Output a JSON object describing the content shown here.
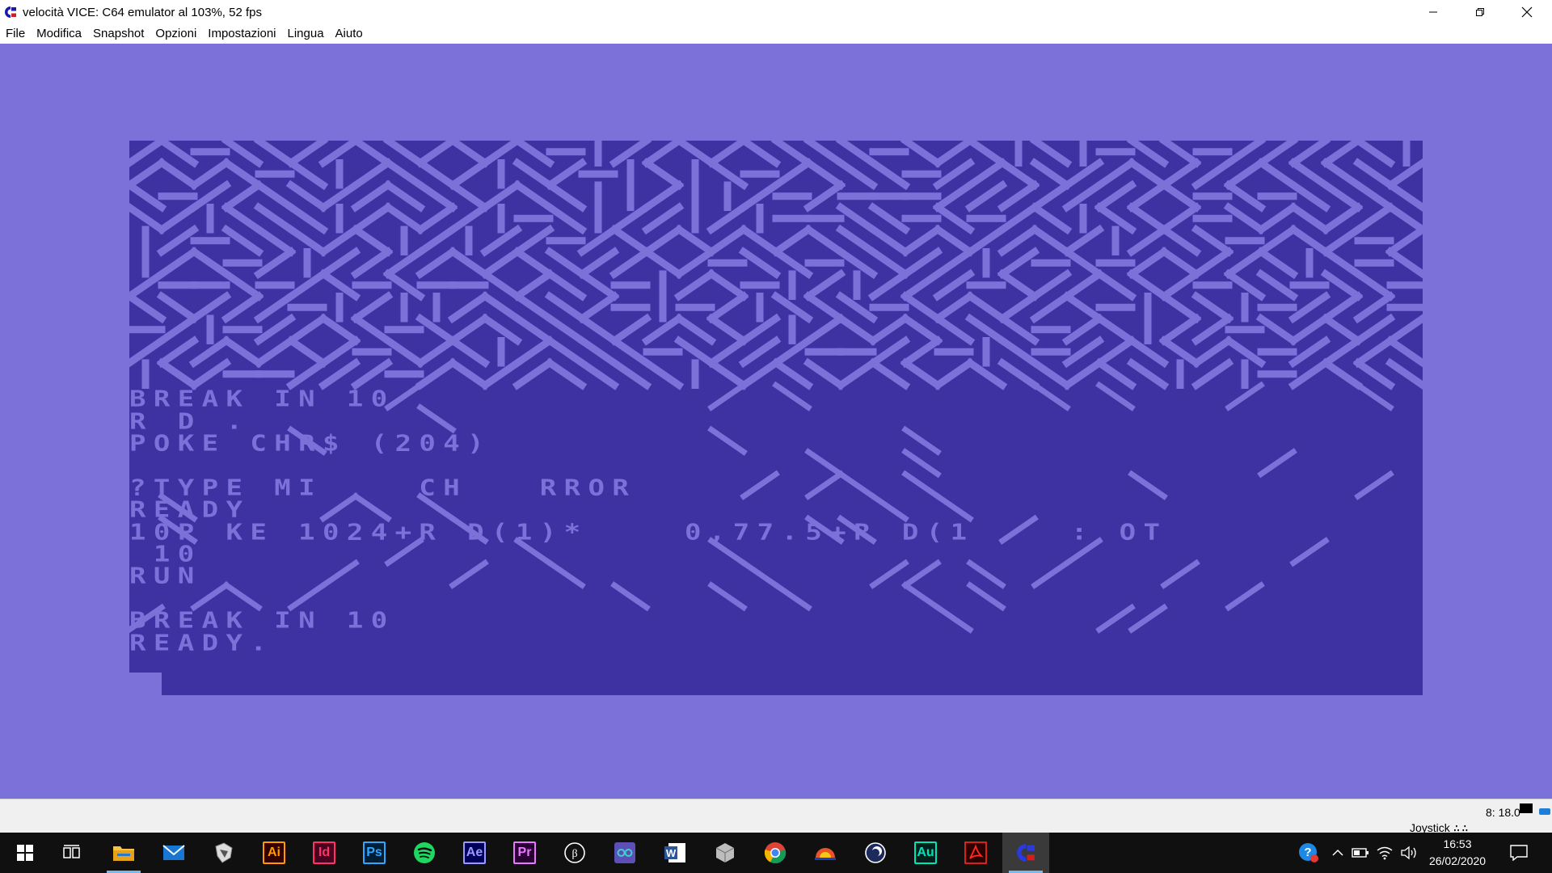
{
  "window": {
    "title": "velocità VICE: C64 emulator al 103%, 52 fps",
    "icon": "vice-commodore-icon"
  },
  "controls": {
    "minimize": "—",
    "maximize": "❐",
    "close": "✕"
  },
  "menu": {
    "items": [
      "File",
      "Modifica",
      "Snapshot",
      "Opzioni",
      "Impostazioni",
      "Lingua",
      "Aiuto"
    ]
  },
  "c64": {
    "border_color": "#7b71d9",
    "background_color": "#3e31a2",
    "text_color": "#7b71d9",
    "lines": [
      "BREAK IN 10",
      "R D .",
      "POKE CHR$ (204)",
      "",
      "?TYPE MI    CH   RROR",
      "READY",
      "10P KE 1024+R D(1)*    0,77.5+R D(1    : OT",
      " 10",
      "RUN",
      "",
      "BREAK IN 10",
      "READY."
    ]
  },
  "status": {
    "speed": "8: 18.0",
    "joystick": "Joystick"
  },
  "taskbar": {
    "apps": [
      {
        "name": "start",
        "icon": "windows-start-icon"
      },
      {
        "name": "task-view",
        "icon": "task-view-icon"
      },
      {
        "name": "file-explorer",
        "icon": "folder-icon"
      },
      {
        "name": "mail",
        "icon": "mail-icon"
      },
      {
        "name": "inkscape",
        "icon": "inkscape-icon"
      },
      {
        "name": "illustrator",
        "label": "Ai",
        "color": "#ff9a00"
      },
      {
        "name": "indesign",
        "label": "Id",
        "color": "#ff3366"
      },
      {
        "name": "photoshop",
        "label": "Ps",
        "color": "#31a8ff"
      },
      {
        "name": "spotify",
        "icon": "spotify-icon"
      },
      {
        "name": "after-effects",
        "label": "Ae",
        "color": "#9999ff"
      },
      {
        "name": "premiere",
        "label": "Pr",
        "color": "#ea77ff"
      },
      {
        "name": "beaker",
        "icon": "beaker-icon"
      },
      {
        "name": "arduino",
        "icon": "arduino-icon"
      },
      {
        "name": "word",
        "icon": "word-icon"
      },
      {
        "name": "cube-app",
        "icon": "cube-icon"
      },
      {
        "name": "chrome",
        "icon": "chrome-icon"
      },
      {
        "name": "blender-like",
        "icon": "orb-icon"
      },
      {
        "name": "cinema4d",
        "icon": "cinema4d-icon"
      },
      {
        "name": "audition",
        "label": "Au",
        "color": "#00e4bb"
      },
      {
        "name": "acrobat",
        "icon": "acrobat-icon"
      },
      {
        "name": "vice",
        "icon": "vice-commodore-icon"
      }
    ],
    "clock_time": "16:53",
    "clock_date": "26/02/2020"
  }
}
